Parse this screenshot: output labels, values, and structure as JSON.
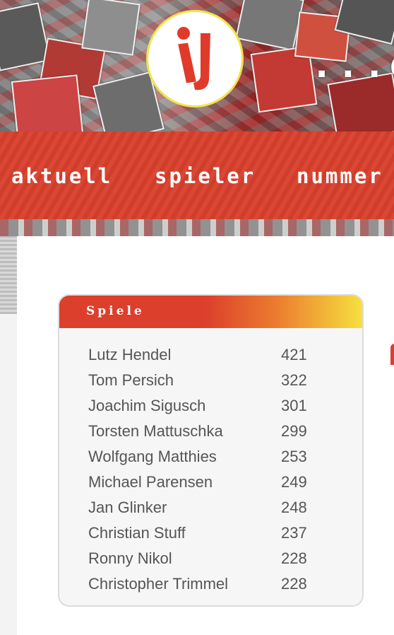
{
  "header": {
    "logo_icon": "club-logo-icon",
    "tagline": "...ei"
  },
  "nav": {
    "items": [
      "aktuell",
      "spieler",
      "nummer"
    ]
  },
  "stats_box": {
    "title": "Spiele",
    "rows": [
      {
        "name": "Lutz Hendel",
        "value": "421"
      },
      {
        "name": "Tom Persich",
        "value": "322"
      },
      {
        "name": "Joachim Sigusch",
        "value": "301"
      },
      {
        "name": "Torsten Mattuschka",
        "value": "299"
      },
      {
        "name": "Wolfgang Matthies",
        "value": "253"
      },
      {
        "name": "Michael Parensen",
        "value": "249"
      },
      {
        "name": "Jan Glinker",
        "value": "248"
      },
      {
        "name": "Christian Stuff",
        "value": "237"
      },
      {
        "name": "Ronny Nikol",
        "value": "228"
      },
      {
        "name": "Christopher Trimmel",
        "value": "228"
      }
    ]
  },
  "colors": {
    "brand_red": "#d8402d",
    "accent_yellow": "#f2e34a"
  }
}
